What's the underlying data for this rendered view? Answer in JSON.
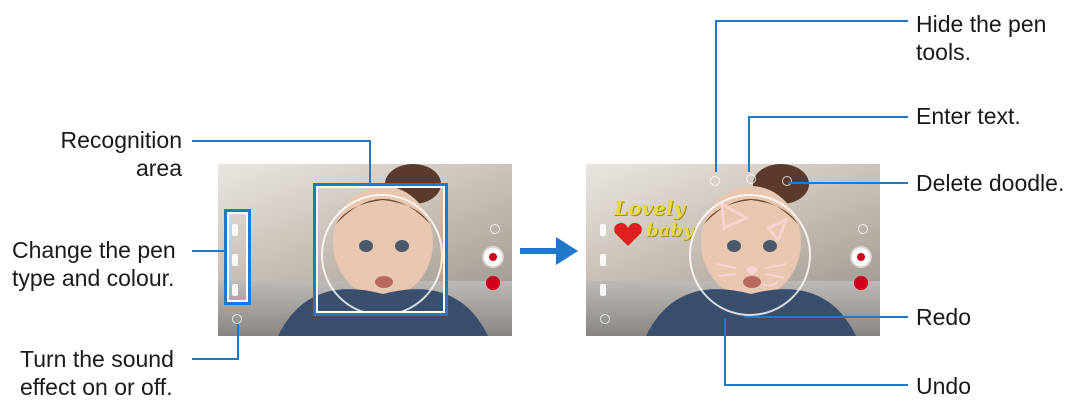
{
  "labels": {
    "recognition_line1": "Recognition",
    "recognition_line2": "area",
    "change_pen_line1": "Change the pen",
    "change_pen_line2": "type and colour.",
    "sound_line1": "Turn the sound",
    "sound_line2": "effect on or off.",
    "hide_pen_line1": "Hide the pen",
    "hide_pen_line2": "tools.",
    "enter_text": "Enter text.",
    "delete_doodle": "Delete doodle.",
    "redo": "Redo",
    "undo": "Undo"
  },
  "doodle": {
    "word1": "Lovely",
    "word2": "baby"
  },
  "colors": {
    "accent_blue": "#1f78c8",
    "record_red": "#d0021b",
    "heart_red": "#e02020",
    "doodle_yellow": "#e7d84a"
  },
  "icons": [
    "record-button-icon",
    "effects-icon",
    "pen-icon",
    "arrow-right-icon",
    "heart-icon"
  ]
}
